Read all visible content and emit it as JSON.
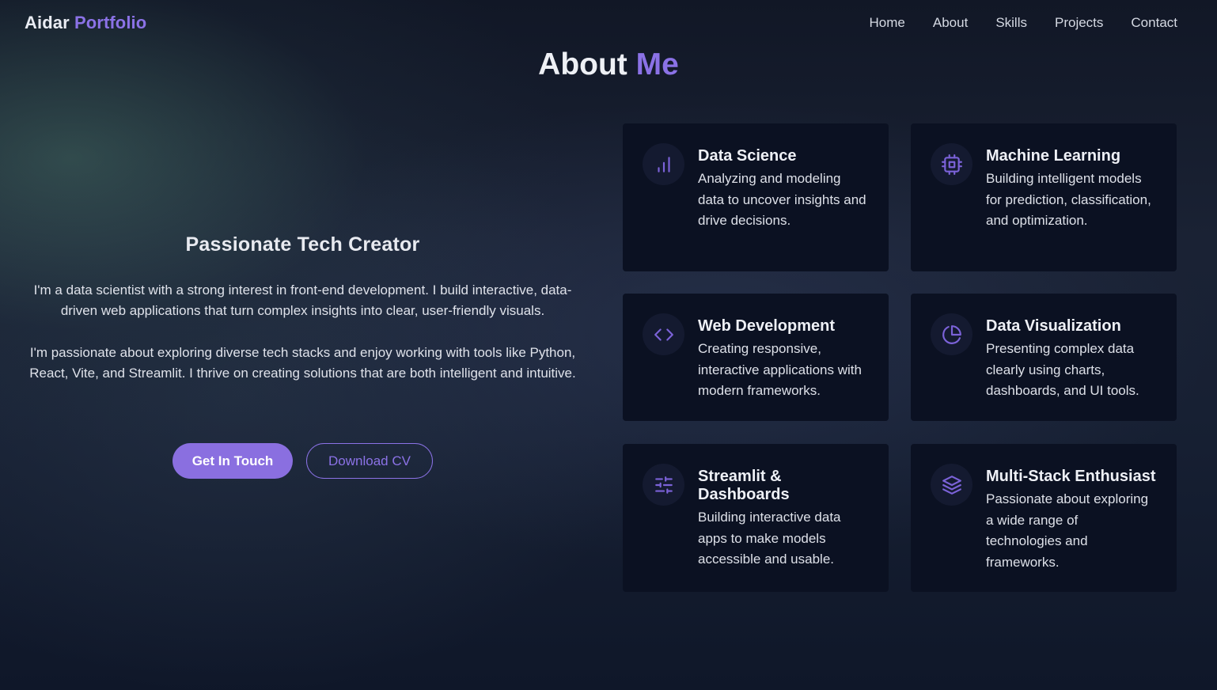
{
  "navbar": {
    "logo_first": "Aidar",
    "logo_second": "Portfolio",
    "links": [
      "Home",
      "About",
      "Skills",
      "Projects",
      "Contact"
    ]
  },
  "section": {
    "title_first": "About",
    "title_second": "Me"
  },
  "intro": {
    "heading": "Passionate Tech Creator",
    "paragraph1": "I'm a data scientist with a strong interest in front-end development. I build interactive, data-driven web applications that turn complex insights into clear, user-friendly visuals.",
    "paragraph2": "I'm passionate about exploring diverse tech stacks and enjoy working with tools like Python, React, Vite, and Streamlit. I thrive on creating solutions that are both intelligent and intuitive.",
    "primary_button": "Get In Touch",
    "secondary_button": "Download CV"
  },
  "cards": [
    {
      "icon": "bar-chart-icon",
      "title": "Data Science",
      "desc": "Analyzing and modeling data to uncover insights and drive decisions."
    },
    {
      "icon": "cpu-icon",
      "title": "Machine Learning",
      "desc": "Building intelligent models for prediction, classification, and optimization."
    },
    {
      "icon": "code-icon",
      "title": "Web Development",
      "desc": "Creating responsive, interactive applications with modern frameworks."
    },
    {
      "icon": "pie-chart-icon",
      "title": "Data Visualization",
      "desc": "Presenting complex data clearly using charts, dashboards, and UI tools."
    },
    {
      "icon": "sliders-icon",
      "title": "Streamlit & Dashboards",
      "desc": "Building interactive data apps to make models accessible and usable."
    },
    {
      "icon": "layers-icon",
      "title": "Multi-Stack Enthusiast",
      "desc": "Passionate about exploring a wide range of technologies and frameworks."
    }
  ],
  "colors": {
    "accent": "#8b72e6",
    "background": "#0e1424",
    "card": "#0b1122"
  }
}
